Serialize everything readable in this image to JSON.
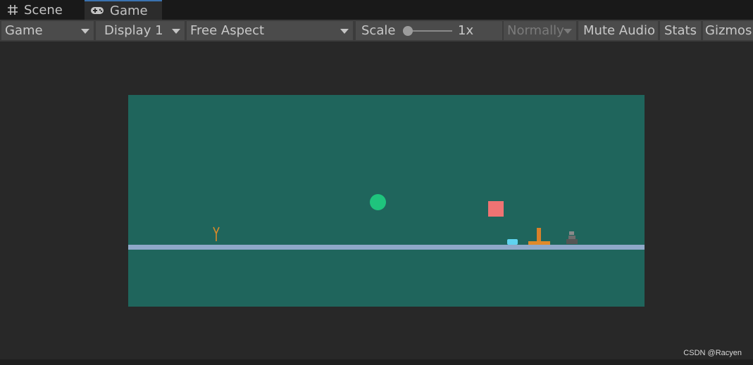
{
  "tabs": [
    {
      "label": "Scene",
      "icon": "grid-icon"
    },
    {
      "label": "Game",
      "icon": "gamepad-icon"
    }
  ],
  "toolbar": {
    "game_dropdown": "Game",
    "display_dropdown": "Display 1",
    "aspect_dropdown": "Free Aspect",
    "scale_label": "Scale",
    "scale_value": "1x",
    "normally_dropdown": "Normally",
    "mute_audio": "Mute Audio",
    "stats": "Stats",
    "gizmos": "Gizmos"
  },
  "colors": {
    "game_background": "#1f655c",
    "ground": "#8fa9c9",
    "ball": "#1fc47d",
    "box": "#ef7373",
    "pad": "#5fd3ef",
    "tee": "#e08a2a"
  },
  "watermark": "CSDN @Racyen"
}
